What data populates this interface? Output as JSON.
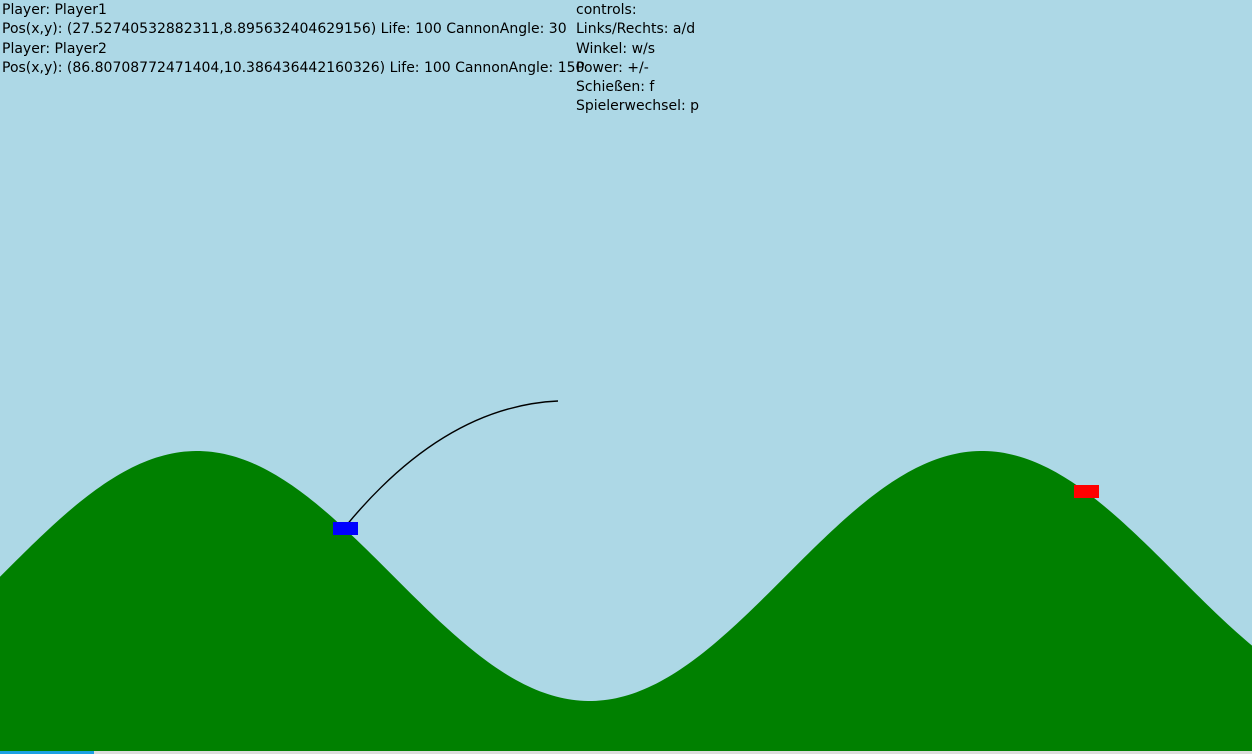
{
  "colors": {
    "sky": "#add8e6",
    "terrain": "#008000",
    "player1_tank": "#0000ff",
    "player2_tank": "#ff0000",
    "trajectory": "#000000",
    "accent": "#1ba1e2"
  },
  "players": [
    {
      "label": "Player: Player1",
      "status": "Pos(x,y): (27.52740532882311,8.895632404629156) Life: 100 CannonAngle: 30"
    },
    {
      "label": "Player: Player2",
      "status": "Pos(x,y): (86.80708772471404,10.386436442160326) Life: 100 CannonAngle: 150"
    }
  ],
  "controls": {
    "title": "controls:",
    "move": "Links/Rechts: a/d",
    "angle": "Winkel: w/s",
    "power": "Power: +/-",
    "shoot": "Schießen: f",
    "switch": "Spielerwechsel: p"
  }
}
